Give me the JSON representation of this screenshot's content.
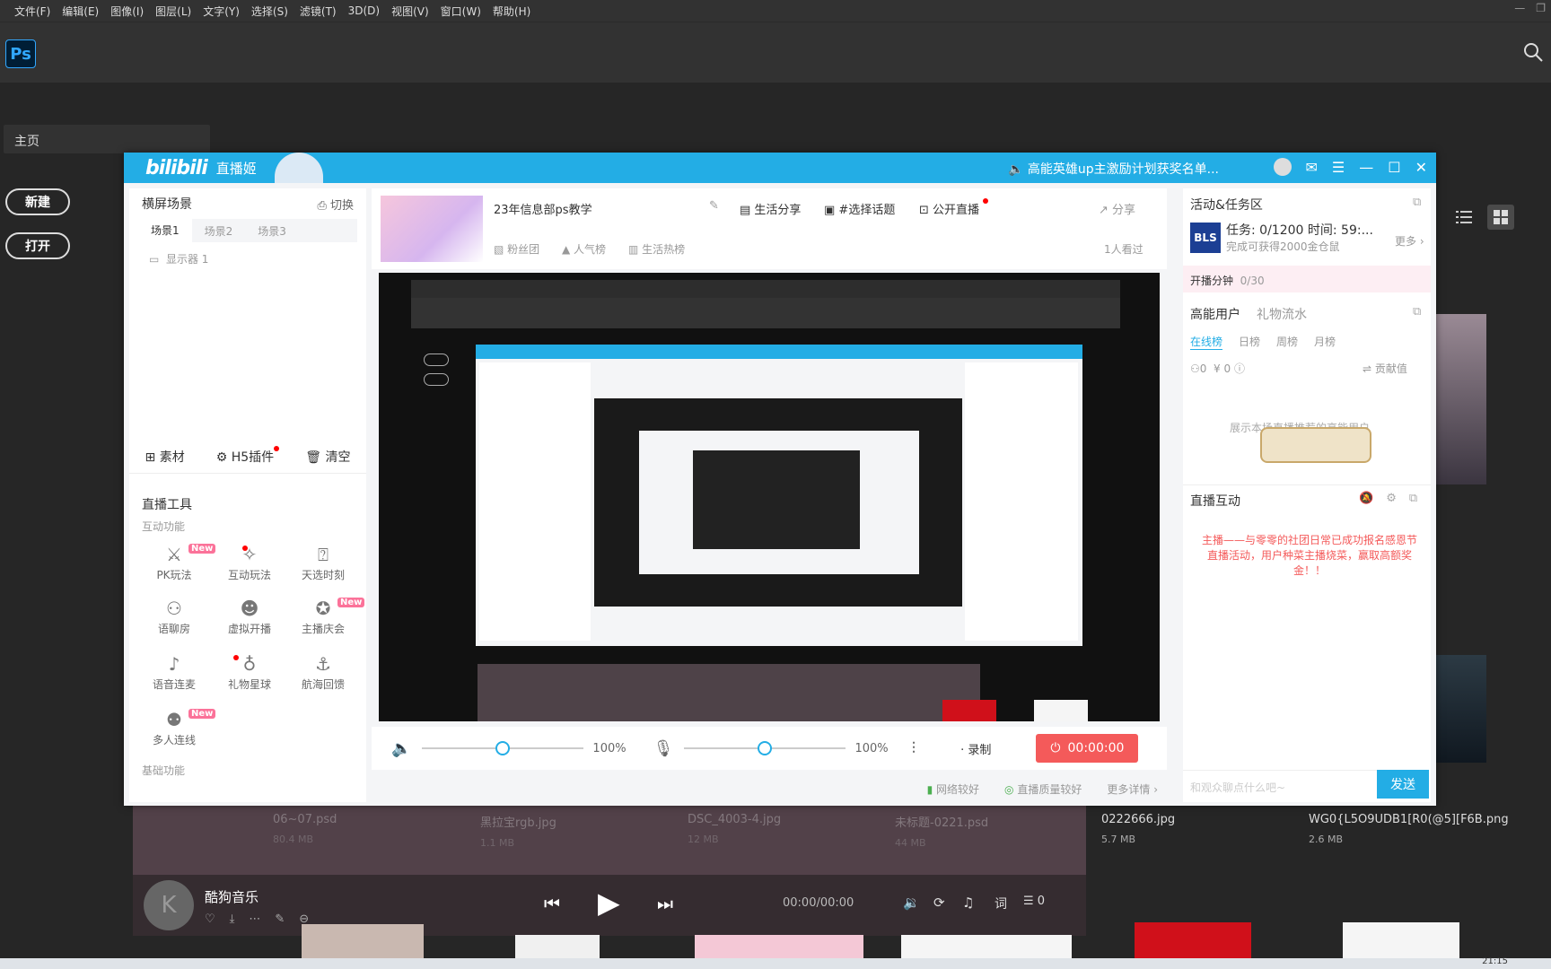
{
  "ps": {
    "menu": [
      "文件(F)",
      "编辑(E)",
      "图像(I)",
      "图层(L)",
      "文字(Y)",
      "选择(S)",
      "滤镜(T)",
      "3D(D)",
      "视图(V)",
      "窗口(W)",
      "帮助(H)"
    ],
    "logo": "Ps",
    "home_label": "主页",
    "new_btn": "新建",
    "open_btn": "打开",
    "files": [
      {
        "name": "06~07.psd",
        "size": "80.4 MB"
      },
      {
        "name": "黑拉宝rgb.jpg",
        "size": "1.1 MB"
      },
      {
        "name": "DSC_4003-4.jpg",
        "size": "12 MB"
      },
      {
        "name": "未标题-0221.psd",
        "size": "44 MB"
      },
      {
        "name": "0222666.jpg",
        "size": "5.7 MB"
      },
      {
        "name": "WG0{L5O9UDB1[R0(@5][F6B.png",
        "size": "2.6 MB"
      }
    ],
    "clock": "21:15"
  },
  "music": {
    "app": "酷狗音乐",
    "time": "00:00/00:00",
    "lyric_btn": "词",
    "queue_count": "0"
  },
  "bili": {
    "brand": "bilibili",
    "brand_sub": "直播姬",
    "notice": "高能英雄up主激励计划获奖名单...",
    "left": {
      "scene_title": "横屏场景",
      "switch_label": "切换",
      "scenes": [
        "场景1",
        "场景2",
        "场景3"
      ],
      "source": "显示器 1",
      "actions": [
        "素材",
        "H5插件",
        "清空"
      ],
      "tools_title": "直播工具",
      "interactive_title": "互动功能",
      "tools": [
        "PK玩法",
        "互动玩法",
        "天选时刻",
        "语聊房",
        "虚拟开播",
        "主播庆会",
        "语音连麦",
        "礼物星球",
        "航海回馈",
        "多人连线"
      ],
      "basic_title": "基础功能",
      "new_tag": "New"
    },
    "center": {
      "room_title": "23年信息部ps教学",
      "category": "生活分享",
      "topic": "#选择话题",
      "public": "公开直播",
      "share": "分享",
      "fans": "粉丝团",
      "popular": "人气榜",
      "hot": "生活热榜",
      "viewers": "1人看过",
      "vol1": "100%",
      "vol2": "100%",
      "record": "录制",
      "live_time": "00:00:00",
      "net": "网络较好",
      "quality": "直播质量较好",
      "more": "更多详情"
    },
    "right": {
      "activity_title": "活动&任务区",
      "task": "任务: 0/1200 时间: 59:...",
      "task_sub": "完成可获得2000金仓鼠",
      "more": "更多",
      "minutes": "开播分钟",
      "minutes_val": "0/30",
      "tab_users": "高能用户",
      "tab_gifts": "礼物流水",
      "ranks": [
        "在线榜",
        "日榜",
        "周榜",
        "月榜"
      ],
      "count": "0",
      "money": "¥ 0",
      "contrib": "贡献值",
      "empty_text": "展示本场直播推荐的高能用户",
      "interact_title": "直播互动",
      "announce": "主播——与零零的社团日常已成功报名感恩节直播活动，用户种菜主播烧菜，赢取高额奖金！！",
      "chat_placeholder": "和观众聊点什么吧~",
      "send": "发送"
    }
  },
  "colors": {
    "bili_blue": "#23ade5",
    "pink": "#fb7299",
    "red": "#f45a5a"
  }
}
